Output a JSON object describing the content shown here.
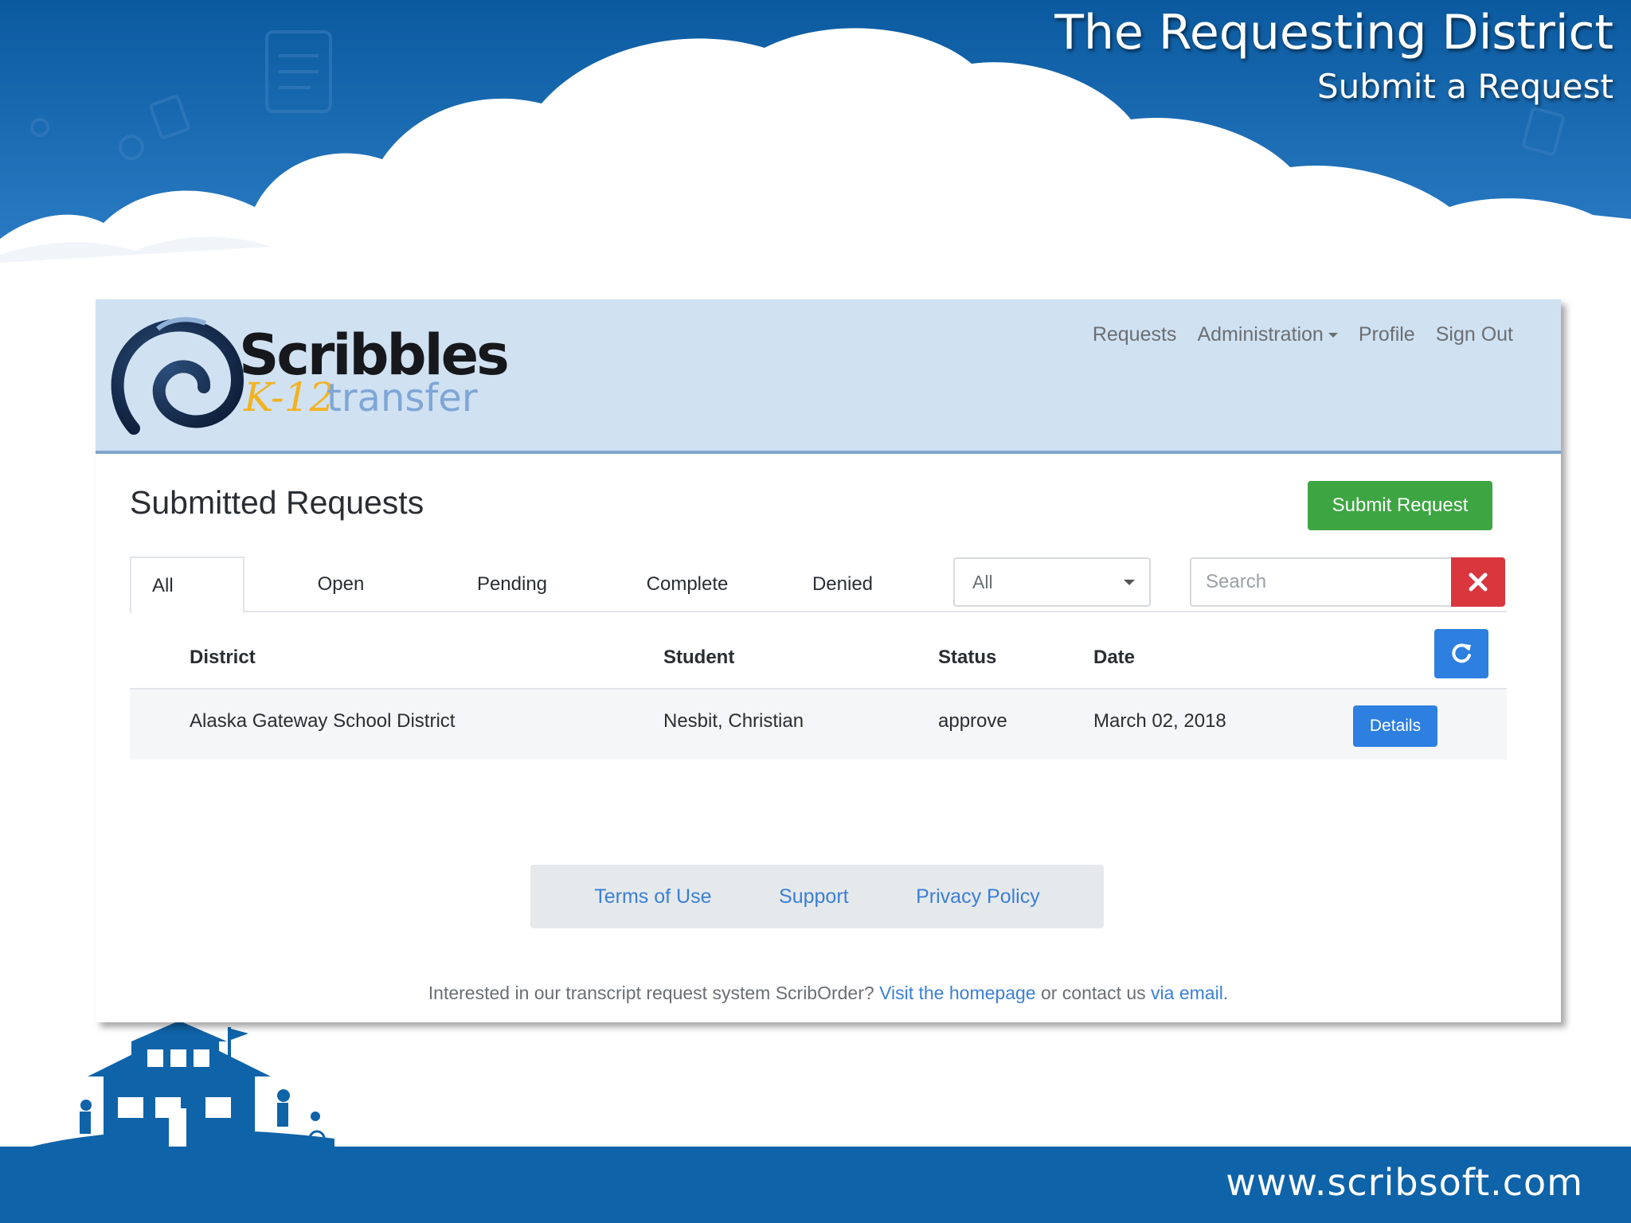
{
  "slide": {
    "title": "The Requesting District",
    "subtitle": "Submit a Request",
    "website": "www.scribsoft.com"
  },
  "app": {
    "logo": {
      "name": "Scribbles",
      "tagline_a": "K-12",
      "tagline_b": "transfer"
    },
    "nav": {
      "requests": "Requests",
      "administration": "Administration",
      "profile": "Profile",
      "sign_out": "Sign Out"
    },
    "page_title": "Submitted Requests",
    "submit_label": "Submit Request",
    "tabs": [
      "All",
      "Open",
      "Pending",
      "Complete",
      "Denied"
    ],
    "select_value": "All",
    "search_placeholder": "Search",
    "table": {
      "headers": {
        "district": "District",
        "student": "Student",
        "status": "Status",
        "date": "Date"
      },
      "rows": [
        {
          "district": "Alaska Gateway School District",
          "student": "Nesbit, Christian",
          "status": "approve",
          "date": "March 02, 2018",
          "action": "Details"
        }
      ]
    },
    "footer": {
      "links": [
        "Terms of Use",
        "Support",
        "Privacy Policy"
      ],
      "text_before": "Interested in our transcript request system ScribOrder?",
      "link_homepage": "Visit the homepage",
      "text_middle": "or contact us",
      "link_email": "via email."
    }
  },
  "colors": {
    "slide_blue": "#0f63a8",
    "navbar_bg": "#d0e1f2",
    "primary": "#2d7fe0",
    "success": "#3da542",
    "danger": "#d9363e"
  }
}
